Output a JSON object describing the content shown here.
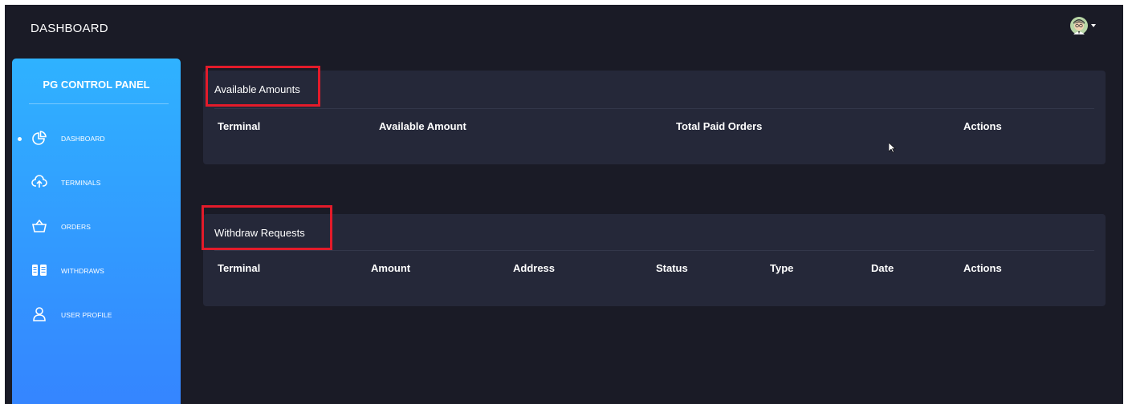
{
  "topbar": {
    "title": "DASHBOARD"
  },
  "sidebar": {
    "brand": "PG CONTROL PANEL",
    "items": [
      {
        "label": "DASHBOARD",
        "icon": "pie-chart-icon",
        "active": true
      },
      {
        "label": "TERMINALS",
        "icon": "cloud-upload-icon",
        "active": false
      },
      {
        "label": "ORDERS",
        "icon": "basket-icon",
        "active": false
      },
      {
        "label": "WITHDRAWS",
        "icon": "money-stack-icon",
        "active": false
      },
      {
        "label": "USER PROFILE",
        "icon": "user-icon",
        "active": false
      }
    ]
  },
  "available": {
    "title": "Available Amounts",
    "columns": [
      "Terminal",
      "Available Amount",
      "Total Paid Orders",
      "Actions"
    ]
  },
  "withdraw": {
    "title": "Withdraw Requests",
    "columns": [
      "Terminal",
      "Amount",
      "Address",
      "Status",
      "Type",
      "Date",
      "Actions"
    ]
  },
  "colors": {
    "background": "#1a1b26",
    "card": "#252839",
    "sidebar_top": "#2fb2ff",
    "sidebar_bottom": "#3584ff",
    "highlight": "#e31b2a"
  }
}
